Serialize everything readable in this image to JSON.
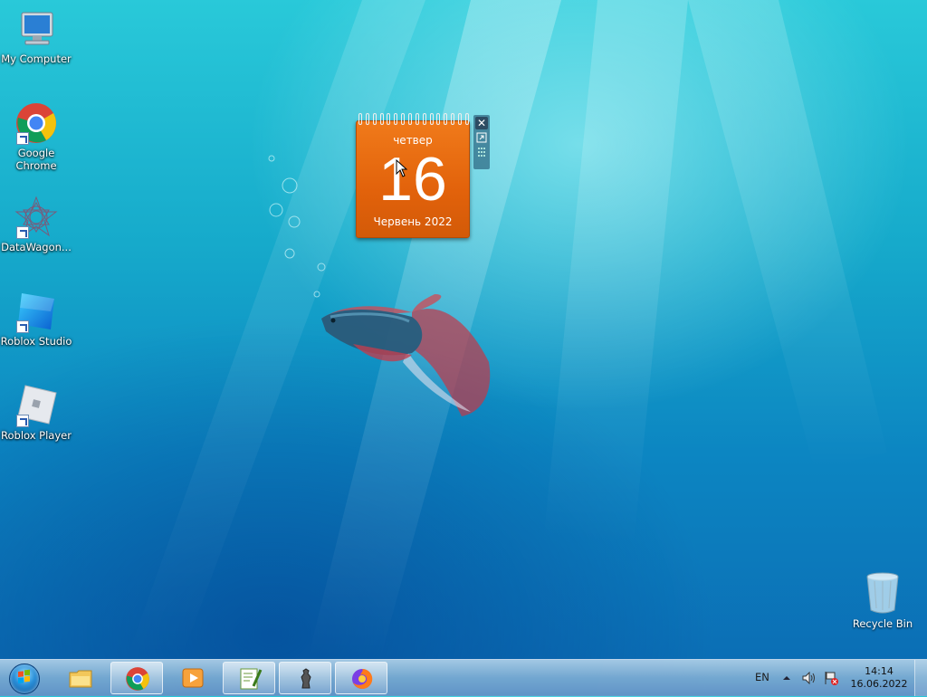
{
  "desktop_icons": [
    {
      "label": "My Computer",
      "icon": "computer-icon"
    },
    {
      "label": "Google\nChrome",
      "label_line1": "Google",
      "label_line2": "Chrome",
      "icon": "chrome-icon"
    },
    {
      "label": "DataWagon...",
      "icon": "datawagon-icon"
    },
    {
      "label": "Roblox Studio",
      "icon": "roblox-studio-icon"
    },
    {
      "label": "Roblox Player",
      "icon": "roblox-player-icon"
    }
  ],
  "recycle_bin": {
    "label": "Recycle Bin",
    "icon": "recycle-bin-icon"
  },
  "calendar_gadget": {
    "day_of_week": "четвер",
    "day": "16",
    "month_year": "Червень 2022",
    "close_glyph": "✕"
  },
  "taskbar": {
    "start": "start-orb-icon",
    "items": [
      {
        "icon": "explorer-icon",
        "active": false
      },
      {
        "icon": "chrome-icon",
        "active": true
      },
      {
        "icon": "media-player-icon",
        "active": false
      },
      {
        "icon": "notepad-plus-icon",
        "active": true
      },
      {
        "icon": "chess-icon",
        "active": true
      },
      {
        "icon": "firefox-icon",
        "active": true
      }
    ]
  },
  "tray": {
    "language": "EN",
    "time": "14:14",
    "date": "16.06.2022"
  },
  "colors": {
    "calendar_orange": "#e2620b",
    "taskbar": "#8fbbe0",
    "desktop_top": "#29c9d9",
    "desktop_bottom": "#0b6ab3"
  }
}
